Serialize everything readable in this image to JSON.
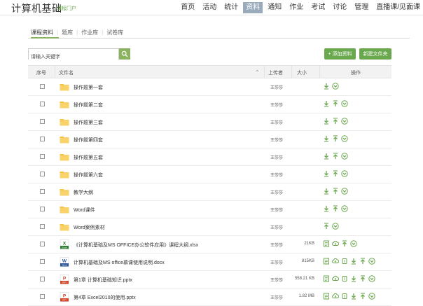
{
  "header": {
    "course_title": "计算机基础",
    "portal_link": "课程门户",
    "nav": [
      "首页",
      "活动",
      "统计",
      "资料",
      "通知",
      "作业",
      "考试",
      "讨论",
      "管理",
      "直播课/见面课"
    ],
    "active_nav_index": 3
  },
  "subtabs": [
    "课程资料",
    "题库",
    "作业库",
    "试卷库"
  ],
  "search": {
    "placeholder": "请输入关键字"
  },
  "buttons": {
    "add": "+ 添加资料",
    "new_folder": "新建文件夹"
  },
  "table": {
    "columns": {
      "index": "序号",
      "filename": "文件名",
      "uploader": "上传者",
      "size": "大小",
      "ops": "操作"
    },
    "rows": [
      {
        "type": "folder",
        "name": "操作题第一套",
        "uploader": "王莎莎",
        "size": "",
        "ops": [
          "download-icon",
          "more-icon"
        ]
      },
      {
        "type": "folder",
        "name": "操作题第二套",
        "uploader": "王莎莎",
        "size": "",
        "ops": [
          "download-icon",
          "upload-icon",
          "more-icon"
        ]
      },
      {
        "type": "folder",
        "name": "操作题第三套",
        "uploader": "王莎莎",
        "size": "",
        "ops": [
          "download-icon",
          "upload-icon",
          "more-icon"
        ]
      },
      {
        "type": "folder",
        "name": "操作题第四套",
        "uploader": "王莎莎",
        "size": "",
        "ops": [
          "download-icon",
          "upload-icon",
          "more-icon"
        ]
      },
      {
        "type": "folder",
        "name": "操作题第五套",
        "uploader": "王莎莎",
        "size": "",
        "ops": [
          "download-icon",
          "upload-icon",
          "more-icon"
        ]
      },
      {
        "type": "folder",
        "name": "操作题第六套",
        "uploader": "王莎莎",
        "size": "",
        "ops": [
          "download-icon",
          "upload-icon",
          "more-icon"
        ]
      },
      {
        "type": "folder",
        "name": "教学大纲",
        "uploader": "王莎莎",
        "size": "",
        "ops": [
          "download-icon",
          "upload-icon",
          "more-icon"
        ]
      },
      {
        "type": "folder",
        "name": "Word课件",
        "uploader": "王莎莎",
        "size": "",
        "ops": [
          "download-icon",
          "upload-icon",
          "more-icon"
        ]
      },
      {
        "type": "folder",
        "name": "Word案例素材",
        "uploader": "王莎莎",
        "size": "",
        "ops": [
          "upload-icon",
          "more-icon"
        ]
      },
      {
        "type": "excel",
        "name": "《计算机基础及MS OFFICE办公软件应用》课程大纲.xlsx",
        "uploader": "王莎莎",
        "size": "21KB",
        "ops": [
          "preview-icon",
          "cloud-icon",
          "upload-icon",
          "more-icon"
        ]
      },
      {
        "type": "word",
        "name": "计算机基础及MS office慕课使用说明.docx",
        "uploader": "王莎莎",
        "size": "815KB",
        "ops": [
          "preview-icon",
          "cloud-icon",
          "link-icon",
          "download-icon",
          "upload-icon",
          "more-icon"
        ]
      },
      {
        "type": "ppt",
        "name": "第1章 计算机基础知识.pptx",
        "uploader": "王莎莎",
        "size": "558.21 KB",
        "ops": [
          "preview-icon",
          "cloud-icon",
          "link-icon",
          "download-icon",
          "upload-icon",
          "more-icon"
        ]
      },
      {
        "type": "ppt",
        "name": "第4章 Excel2010的使用.pptx",
        "uploader": "王莎莎",
        "size": "1.82 MB",
        "ops": [
          "preview-icon",
          "cloud-icon",
          "link-icon",
          "download-icon",
          "upload-icon",
          "more-icon"
        ]
      }
    ]
  },
  "colors": {
    "accent": "#6aa84f",
    "folder": "#f5c242",
    "active_nav_bg": "#99aabb"
  }
}
